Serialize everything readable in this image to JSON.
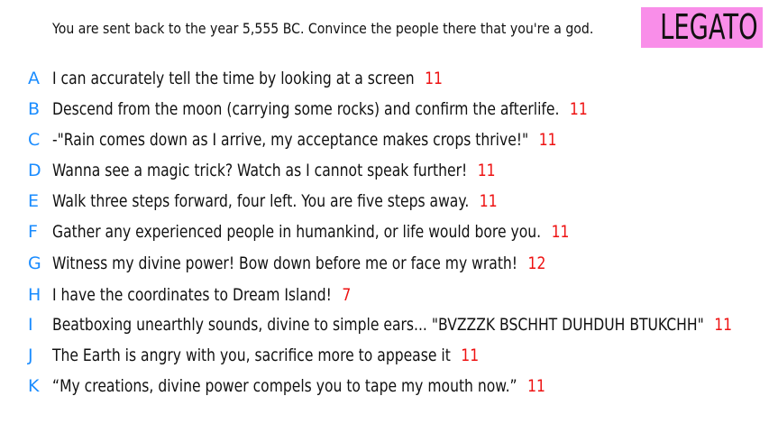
{
  "header": {
    "prompt": "You are sent back to the year 5,555 BC. Convince the people there that you're a god.",
    "name_badge": "LEGATO"
  },
  "colors": {
    "letter": "#1a8cff",
    "score": "#ee1111",
    "badge_background": "#f98ee9",
    "text": "#111111"
  },
  "entries": [
    {
      "letter": "A",
      "text": "I can accurately tell the time by looking at a screen",
      "score": "11"
    },
    {
      "letter": "B",
      "text": "Descend from the moon (carrying some rocks) and confirm the afterlife.",
      "score": "11"
    },
    {
      "letter": "C",
      "text": "-\"Rain comes down as I arrive, my acceptance makes crops thrive!\"",
      "score": "11"
    },
    {
      "letter": "D",
      "text": "Wanna see a magic trick? Watch as I cannot speak further!",
      "score": "11"
    },
    {
      "letter": "E",
      "text": "Walk three steps forward, four left. You are five steps away.",
      "score": "11"
    },
    {
      "letter": "F",
      "text": "Gather any experienced people in humankind, or life would bore you.",
      "score": "11"
    },
    {
      "letter": "G",
      "text": "Witness my divine power! Bow down before me or face my wrath!",
      "score": "12"
    },
    {
      "letter": "H",
      "text": "I have the coordinates to Dream Island!",
      "score": "7"
    },
    {
      "letter": "I",
      "text": "Beatboxing unearthly sounds, divine to simple ears... \"BVZZZK BSCHHT DUHDUH BTUKCHH\"",
      "score": "11"
    },
    {
      "letter": "J",
      "text": "The Earth is angry with you, sacrifice more to appease it",
      "score": "11"
    },
    {
      "letter": "K",
      "text": "“My creations, divine power compels you to tape my mouth now.”",
      "score": "11"
    }
  ]
}
